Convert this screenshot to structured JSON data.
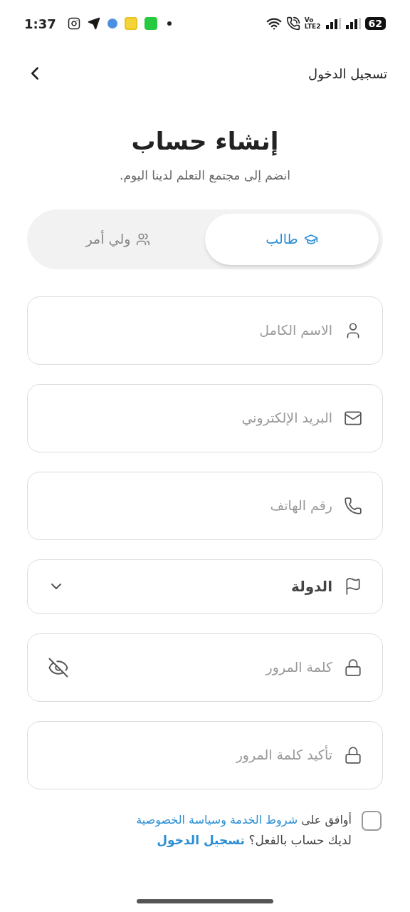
{
  "status_bar": {
    "time": "1:37",
    "network_top": "Vo",
    "network_bottom": "LTE2",
    "battery": "62"
  },
  "header": {
    "login_link": "تسجيل الدخول"
  },
  "title": "إنشاء حساب",
  "subtitle": "انضم إلى مجتمع التعلم لدينا اليوم.",
  "role_tabs": [
    {
      "kind": "student",
      "label": "طالب",
      "selected": true
    },
    {
      "kind": "guardian",
      "label": "ولي أمر",
      "selected": false
    }
  ],
  "fields": [
    {
      "kind": "name",
      "placeholder": "الاسم الكامل"
    },
    {
      "kind": "email",
      "placeholder": "البريد الإلكتروني"
    },
    {
      "kind": "phone",
      "placeholder": "رقم الهاتف"
    },
    {
      "kind": "country",
      "value": "الدولة"
    },
    {
      "kind": "password",
      "placeholder": "كلمة المرور"
    },
    {
      "kind": "confirm",
      "placeholder": "تأكيد كلمة المرور"
    }
  ],
  "terms": {
    "checked": false,
    "text": "أوافق على",
    "link": "شروط الخدمة وسياسة الخصوصية"
  },
  "login_prompt": {
    "text": "لديك حساب بالفعل؟",
    "link": "تسجيل الدخول"
  }
}
